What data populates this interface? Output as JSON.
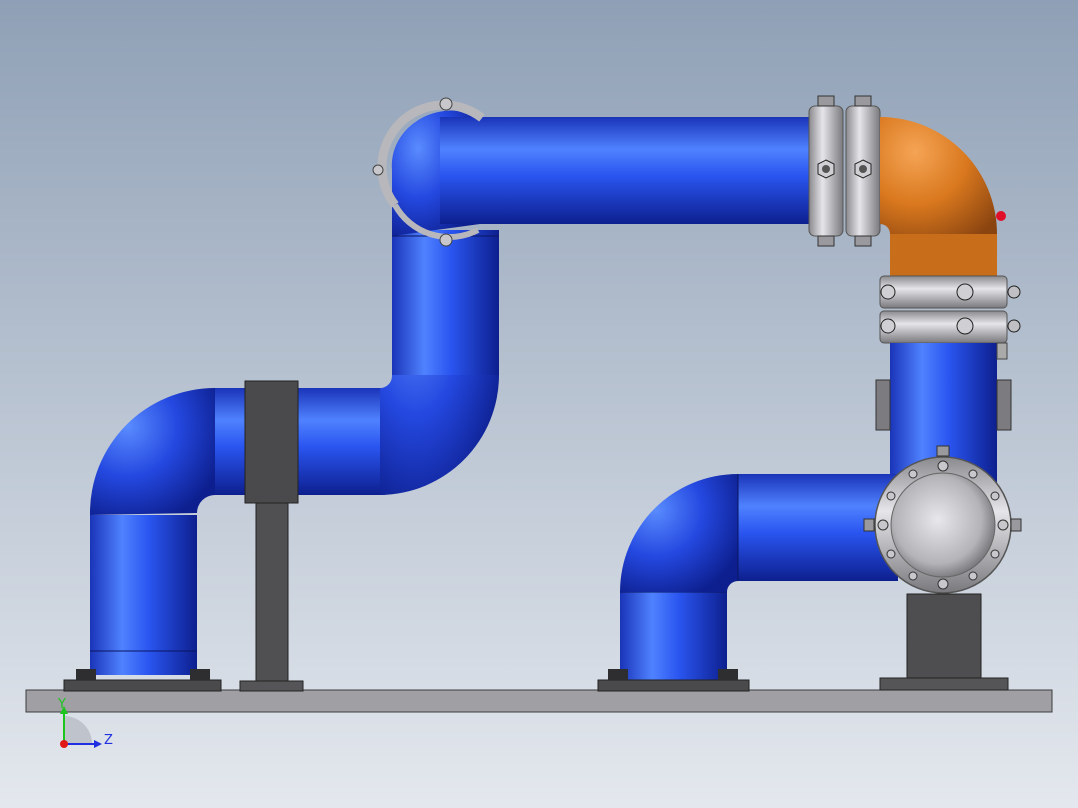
{
  "viewport": {
    "background_top": "#8fa0b6",
    "background_bottom": "#e4e8ee"
  },
  "colors": {
    "pipe_blue": "#1c3fd8",
    "pipe_blue_light": "#4a7cff",
    "pipe_blue_dark": "#0f2496",
    "elbow_copper": "#d9781e",
    "elbow_copper_light": "#f0a050",
    "flange_steel": "#c8c8cc",
    "flange_steel_dark": "#7c7c80",
    "support_dark": "#4a4a4c",
    "base_plate": "#9a9a9e",
    "marker_red": "#e0102a"
  },
  "triad": {
    "y_label": "Y",
    "z_label": "Z",
    "y_color": "#1ec41e",
    "z_color": "#2030e0",
    "x_color": "#e01818",
    "icon": "coordinate-triad-icon"
  }
}
